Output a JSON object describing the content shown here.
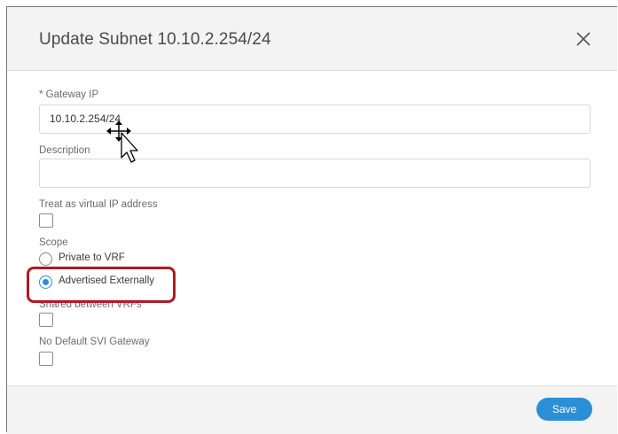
{
  "dialog": {
    "title": "Update Subnet 10.10.2.254/24",
    "close_icon": "close-icon"
  },
  "form": {
    "gateway_ip": {
      "label": "* Gateway IP",
      "value": "10.10.2.254/24"
    },
    "description": {
      "label": "Description",
      "value": ""
    },
    "virtual_ip": {
      "label": "Treat as virtual IP address",
      "checked": false
    },
    "scope": {
      "label": "Scope",
      "options": [
        {
          "label": "Private to VRF",
          "selected": false
        },
        {
          "label": "Advertised Externally",
          "selected": true
        }
      ]
    },
    "shared_between_vrfs": {
      "label": "Shared between VRFs",
      "checked": false
    },
    "no_default_svi": {
      "label": "No Default SVI Gateway",
      "checked": false
    }
  },
  "footer": {
    "save_label": "Save"
  },
  "colors": {
    "accent": "#2b8fd6",
    "highlight": "#b01a24"
  },
  "icons": {
    "cursor": "move-cursor-icon",
    "pointer": "arrow-pointer-icon"
  }
}
